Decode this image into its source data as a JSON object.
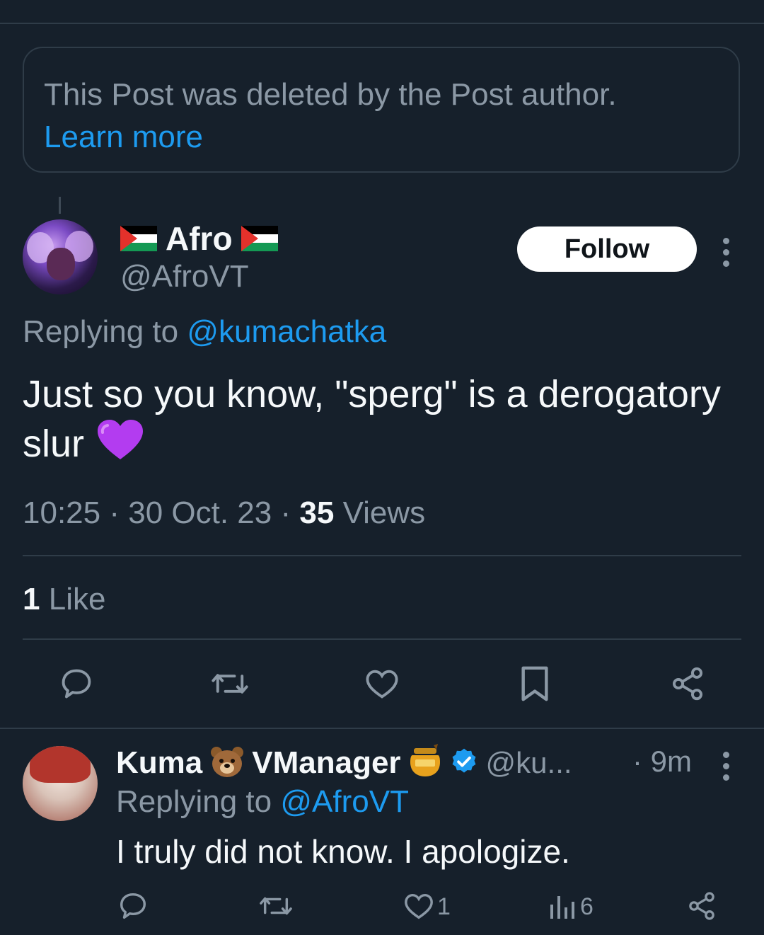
{
  "deleted_notice": {
    "text": "This Post was deleted by the Post author.",
    "link": "Learn more"
  },
  "post": {
    "display_name": "Afro",
    "handle": "@AfroVT",
    "follow_label": "Follow",
    "replying_prefix": "Replying to",
    "replying_to": "@kumachatka",
    "text": "Just so you know, \"sperg\" is a derogatory slur",
    "time": "10:25",
    "date": "30 Oct. 23",
    "views_count": "35",
    "views_label": "Views",
    "likes_count": "1",
    "likes_label": "Like",
    "separator": "·"
  },
  "reply": {
    "name_part1": "Kuma",
    "name_part2": "VManager",
    "handle": "@ku...",
    "time": "· 9m",
    "replying_prefix": "Replying to",
    "replying_to": "@AfroVT",
    "text": "I truly did not know. I apologize.",
    "like_count": "1",
    "views_count": "6"
  },
  "colors": {
    "background": "#16202b",
    "accent": "#1d9bf0",
    "muted": "#8b98a5",
    "heart_emoji": "#b33cf0"
  },
  "icons": [
    "comment-icon",
    "repost-icon",
    "like-icon",
    "bookmark-icon",
    "share-icon",
    "more-icon",
    "verified-icon",
    "views-icon",
    "palestine-flag-icon",
    "bear-emoji",
    "honey-pot-emoji",
    "purple-heart-emoji"
  ]
}
